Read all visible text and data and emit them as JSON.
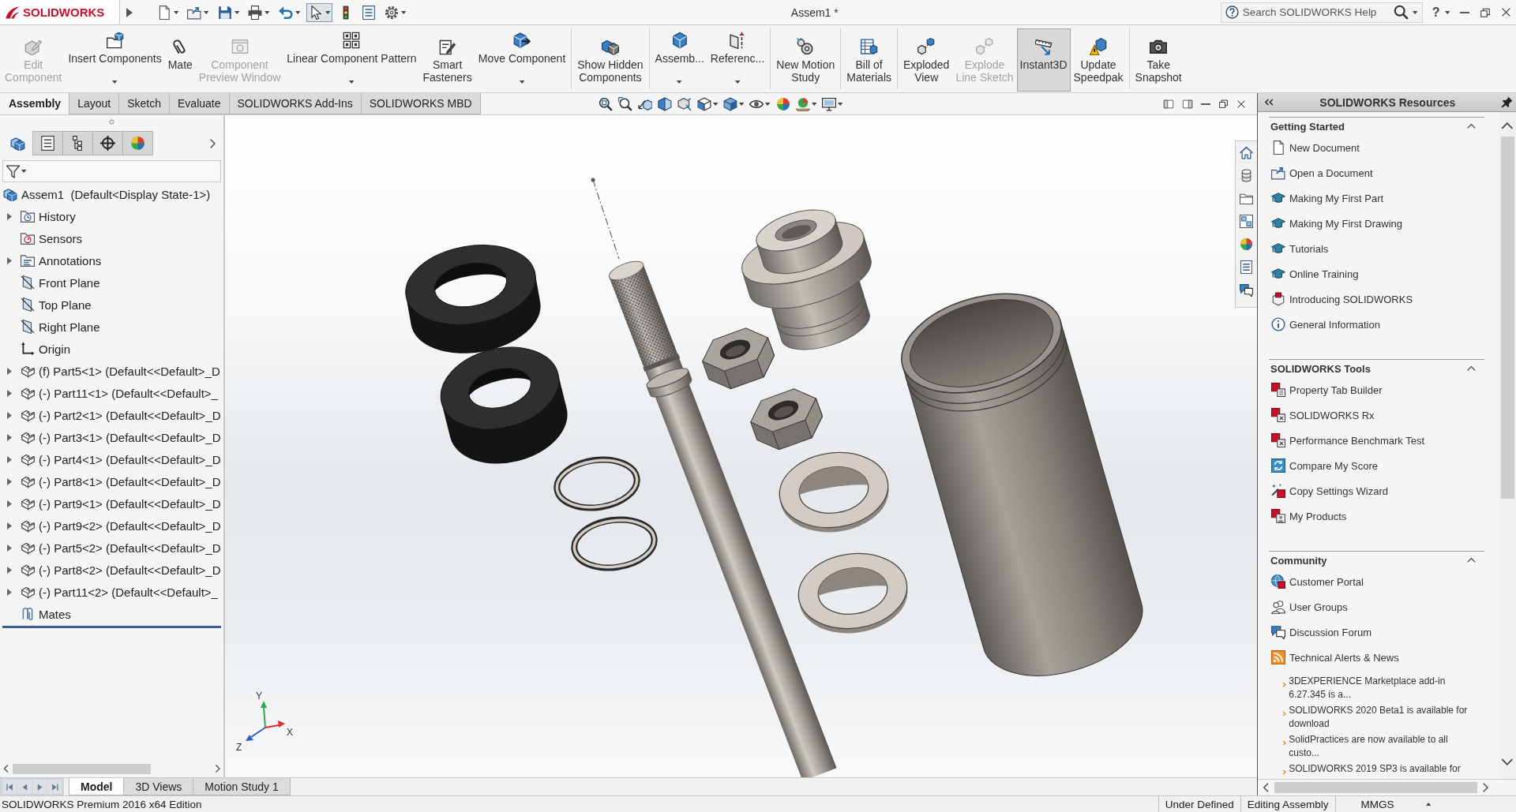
{
  "title_bar": {
    "logo": "SOLIDWORKS",
    "document_title": "Assem1 *",
    "search": {
      "placeholder": "Search SOLIDWORKS Help"
    },
    "help": "?"
  },
  "quick_access": [
    {
      "dropdown": true,
      "selected": false
    },
    {
      "dropdown": true,
      "selected": false
    },
    {
      "dropdown": true,
      "selected": false
    },
    {
      "dropdown": true,
      "selected": false
    },
    {
      "dropdown": true,
      "selected": false
    },
    {
      "dropdown": true,
      "selected": true
    },
    {
      "dropdown": false,
      "selected": false
    },
    {
      "dropdown": false,
      "selected": false
    },
    {
      "dropdown": true,
      "selected": false
    }
  ],
  "command_manager": {
    "groups": [
      [
        {
          "label": "Edit\nComponent",
          "disabled": true,
          "on": false,
          "dropdown": false
        },
        {
          "label": "Insert Components",
          "disabled": false,
          "on": false,
          "dropdown": true
        },
        {
          "label": "Mate",
          "disabled": false,
          "on": false,
          "dropdown": false
        },
        {
          "label": "Component\nPreview Window",
          "disabled": true,
          "on": false,
          "dropdown": false
        },
        {
          "label": "Linear Component Pattern",
          "disabled": false,
          "on": false,
          "dropdown": true
        },
        {
          "label": "Smart\nFasteners",
          "disabled": false,
          "on": false,
          "dropdown": false
        },
        {
          "label": "Move Component",
          "disabled": false,
          "on": false,
          "dropdown": true
        }
      ],
      [
        {
          "label": "Show Hidden\nComponents",
          "disabled": false,
          "on": false,
          "dropdown": false
        }
      ],
      [
        {
          "label": "Assemb...",
          "disabled": false,
          "on": false,
          "dropdown": true
        },
        {
          "label": "Referenc...",
          "disabled": false,
          "on": false,
          "dropdown": true
        }
      ],
      [
        {
          "label": "New Motion\nStudy",
          "disabled": false,
          "on": false,
          "dropdown": false
        }
      ],
      [
        {
          "label": "Bill of\nMaterials",
          "disabled": false,
          "on": false,
          "dropdown": false
        }
      ],
      [
        {
          "label": "Exploded\nView",
          "disabled": false,
          "on": false,
          "dropdown": false
        },
        {
          "label": "Explode\nLine Sketch",
          "disabled": true,
          "on": false,
          "dropdown": false
        },
        {
          "label": "Instant3D",
          "disabled": false,
          "on": true,
          "dropdown": false
        },
        {
          "label": "Update\nSpeedpak",
          "disabled": false,
          "on": false,
          "dropdown": false
        }
      ],
      [
        {
          "label": "Take\nSnapshot",
          "disabled": false,
          "on": false,
          "dropdown": false
        }
      ]
    ],
    "tabs": [
      {
        "label": "Assembly",
        "selected": true
      },
      {
        "label": "Layout",
        "selected": false
      },
      {
        "label": "Sketch",
        "selected": false
      },
      {
        "label": "Evaluate",
        "selected": false
      },
      {
        "label": "SOLIDWORKS Add-Ins",
        "selected": false
      },
      {
        "label": "SOLIDWORKS MBD",
        "selected": false
      }
    ]
  },
  "view_toolbar": [
    {
      "dropdown": false
    },
    {
      "dropdown": false
    },
    {
      "dropdown": false
    },
    {
      "dropdown": false
    },
    {
      "dropdown": false
    },
    {
      "dropdown": true
    },
    {
      "dropdown": true
    },
    {
      "dropdown": true
    },
    {
      "dropdown": false
    },
    {
      "dropdown": true
    },
    {
      "dropdown": true
    }
  ],
  "feature_manager": {
    "tabs": [
      {
        "selected": true
      },
      {
        "selected": false
      },
      {
        "selected": false
      },
      {
        "selected": false
      },
      {
        "selected": false
      }
    ],
    "tree": {
      "label": "Assem1  (Default<Display State-1>)",
      "kind": "assembly",
      "children": [
        {
          "label": "History",
          "kind": "history",
          "expandable": true
        },
        {
          "label": "Sensors",
          "kind": "sensors",
          "expandable": false
        },
        {
          "label": "Annotations",
          "kind": "annotations",
          "expandable": true
        },
        {
          "label": "Front Plane",
          "kind": "plane",
          "expandable": false
        },
        {
          "label": "Top Plane",
          "kind": "plane",
          "expandable": false
        },
        {
          "label": "Right Plane",
          "kind": "plane",
          "expandable": false
        },
        {
          "label": "Origin",
          "kind": "origin",
          "expandable": false
        },
        {
          "label": "(f) Part5<1> (Default<<Default>_D",
          "kind": "part",
          "expandable": true
        },
        {
          "label": "(-) Part11<1> (Default<<Default>_",
          "kind": "part",
          "expandable": true
        },
        {
          "label": "(-) Part2<1> (Default<<Default>_D",
          "kind": "part",
          "expandable": true
        },
        {
          "label": "(-) Part3<1> (Default<<Default>_D",
          "kind": "part",
          "expandable": true
        },
        {
          "label": "(-) Part4<1> (Default<<Default>_D",
          "kind": "part",
          "expandable": true
        },
        {
          "label": "(-) Part8<1> (Default<<Default>_D",
          "kind": "part",
          "expandable": true
        },
        {
          "label": "(-) Part9<1> (Default<<Default>_D",
          "kind": "part",
          "expandable": true
        },
        {
          "label": "(-) Part9<2> (Default<<Default>_D",
          "kind": "part",
          "expandable": true
        },
        {
          "label": "(-) Part5<2> (Default<<Default>_D",
          "kind": "part",
          "expandable": true
        },
        {
          "label": "(-) Part8<2> (Default<<Default>_D",
          "kind": "part",
          "expandable": true
        },
        {
          "label": "(-) Part11<2> (Default<<Default>_",
          "kind": "part",
          "expandable": true
        },
        {
          "label": "Mates",
          "kind": "mates",
          "expandable": false
        }
      ]
    }
  },
  "viewport": {
    "triad": {
      "x": "X",
      "y": "Y",
      "z": "Z"
    }
  },
  "task_pane": {
    "title": "SOLIDWORKS Resources",
    "sections": [
      {
        "title": "Getting Started",
        "expanded": true,
        "items": [
          "New Document",
          "Open a Document",
          "Making My First Part",
          "Making My First Drawing",
          "Tutorials",
          "Online Training",
          "Introducing SOLIDWORKS",
          "General Information"
        ]
      },
      {
        "title": "SOLIDWORKS Tools",
        "expanded": true,
        "items": [
          "Property Tab Builder",
          "SOLIDWORKS Rx",
          "Performance Benchmark Test",
          "Compare My Score",
          "Copy Settings Wizard",
          "My Products"
        ]
      },
      {
        "title": "Community",
        "expanded": true,
        "items": [
          "Customer Portal",
          "User Groups",
          "Discussion Forum",
          "Technical Alerts & News"
        ],
        "news": [
          "3DEXPERIENCE Marketplace add-in\n6.27.345 is a...",
          "SOLIDWORKS 2020 Beta1 is available for\ndownload",
          "SolidPractices are now available to all\ncusto...",
          "SOLIDWORKS 2019 SP3 is available for"
        ]
      }
    ]
  },
  "bottom_tabs": [
    {
      "label": "Model",
      "selected": true
    },
    {
      "label": "3D Views",
      "selected": false
    },
    {
      "label": "Motion Study 1",
      "selected": false
    }
  ],
  "status_bar": {
    "edition": "SOLIDWORKS Premium 2016 x64 Edition",
    "fields": [
      "Under Defined",
      "Editing Assembly",
      "MMGS"
    ]
  }
}
